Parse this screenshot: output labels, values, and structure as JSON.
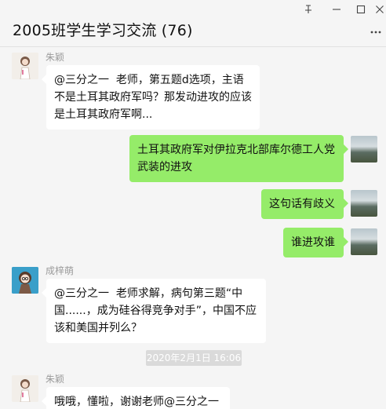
{
  "window": {
    "title": "2005班学生学习交流 (76)",
    "pin_icon": "pin-icon",
    "minimize_icon": "minimize-icon",
    "maximize_icon": "maximize-icon",
    "close_icon": "close-icon",
    "more_icon": "more-icon"
  },
  "messages": [
    {
      "sender": "朱颖",
      "text": "@三分之一  老师，第五题d选项，主语不是土耳其政府军吗？那发动进攻的应该是土耳其政府军啊..."
    },
    {
      "text": "土耳其政府军对伊拉克北部库尔德工人党武装的进攻"
    },
    {
      "text": "这句话有歧义"
    },
    {
      "text": "谁进攻谁"
    },
    {
      "sender": "成梓萌",
      "text": "@三分之一  老师求解，病句第三题“中国......，成为硅谷得竞争对手”，中国不应该和美国并列么？"
    },
    {
      "timestamp": "2020年2月1日  16:06"
    },
    {
      "sender": "朱颖",
      "text": "哦哦，懂啦，谢谢老师@三分之一"
    }
  ]
}
